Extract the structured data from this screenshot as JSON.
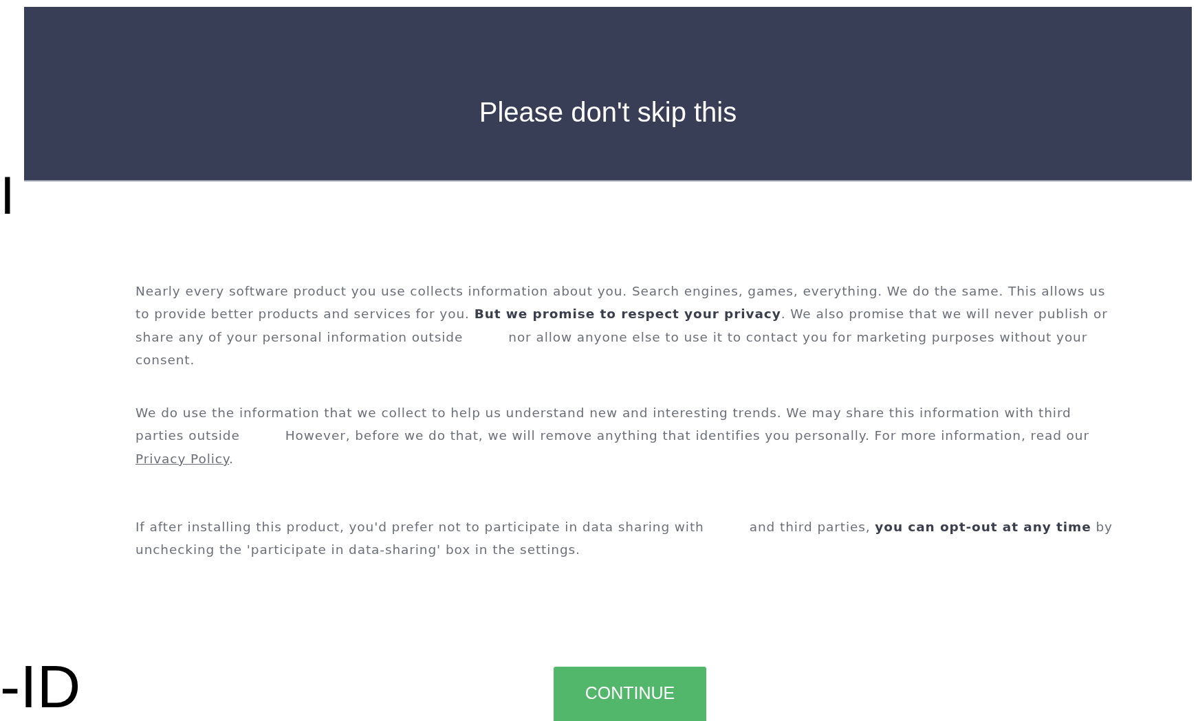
{
  "edge_fragments": [
    {
      "text": "I"
    },
    {
      "text": "-ID"
    }
  ],
  "header": {
    "title": "Please don't skip this"
  },
  "paragraphs": [
    {
      "segments": [
        {
          "kind": "text",
          "text": "Nearly every software product you use collects information about you. Search engines, games, everything. We do the same. This allows us to provide better products and services for you. **But we promise to respect your privacy**. We also promise that we will never publish or share any of your personal information outside"
        },
        {
          "kind": "gap"
        },
        {
          "kind": "text",
          "text": "nor allow anyone else to use it to contact you for marketing purposes without your consent."
        }
      ]
    },
    {
      "segments": [
        {
          "kind": "text",
          "text": "We do use the information that we collect to help us understand new and interesting trends. We may share this information with third parties outside"
        },
        {
          "kind": "gap"
        },
        {
          "kind": "text",
          "text": "However, before we do that, we will remove anything that identifies you personally. For more information, read our "
        },
        {
          "kind": "link",
          "text": "Privacy Policy"
        },
        {
          "kind": "text",
          "text": "."
        }
      ]
    },
    {
      "segments": [
        {
          "kind": "text",
          "text": "If after installing this product, you'd prefer not to participate in data sharing with"
        },
        {
          "kind": "gap"
        },
        {
          "kind": "text",
          "text": "and third parties, **you can opt-out at any time** by unchecking the 'participate in data-sharing' box in the settings."
        }
      ]
    }
  ],
  "continue_button": {
    "label": "CONTINUE"
  }
}
